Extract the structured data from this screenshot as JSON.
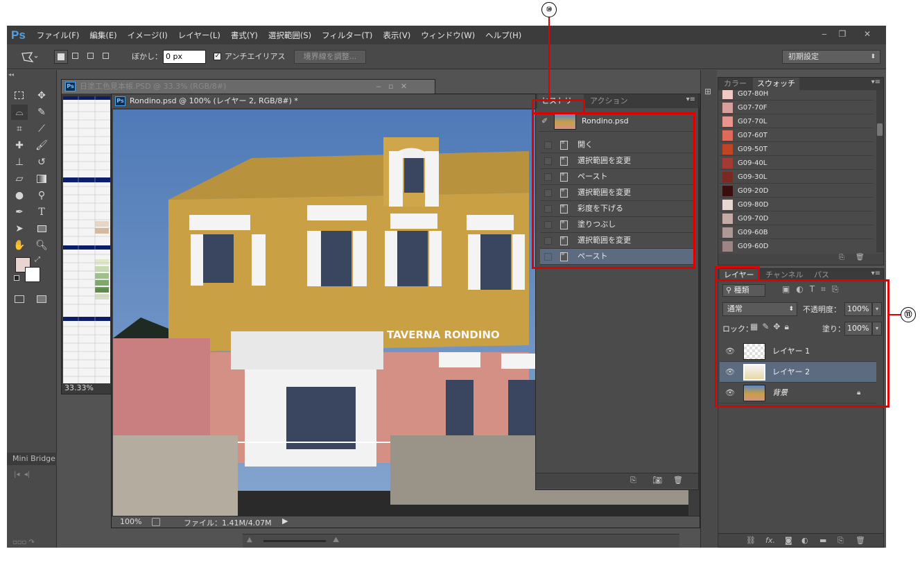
{
  "callouts": {
    "history": "⑩",
    "layers": "⑪"
  },
  "menubar": {
    "logo": "Ps",
    "items": [
      "ファイル(F)",
      "編集(E)",
      "イメージ(I)",
      "レイヤー(L)",
      "書式(Y)",
      "選択範囲(S)",
      "フィルター(T)",
      "表示(V)",
      "ウィンドウ(W)",
      "ヘルプ(H)"
    ],
    "minimize": "‒",
    "restore": "❐",
    "close": "✕"
  },
  "options": {
    "feather_label": "ぼかし：",
    "feather_value": "0 px",
    "antialias_label": "アンチエイリアス",
    "antialias_checked": true,
    "refine_edge": "境界線を調整...",
    "workspace": "初期設定"
  },
  "doc1": {
    "title": "日塗工色見本帳.PSD @ 33.3% (RGB/8#)",
    "zoom": "33.33%"
  },
  "doc2": {
    "title": "Rondino.psd @ 100% (レイヤー 2, RGB/8#) *",
    "zoom": "100%",
    "file_info": "ファイル：1.41M/4.07M",
    "sign_text": "TAVERNA RONDINO"
  },
  "mini_bridge": {
    "title": "Mini Bridge"
  },
  "history": {
    "tabs": [
      "ヒストリー",
      "アクション"
    ],
    "snapshot": "Rondino.psd",
    "states": [
      "開く",
      "選択範囲を変更",
      "ペースト",
      "選択範囲を変更",
      "彩度を下げる",
      "塗りつぶし",
      "選択範囲を変更",
      "ペースト"
    ],
    "selected_index": 7
  },
  "color_panel": {
    "tabs": [
      "カラー",
      "スウォッチ"
    ],
    "swatches": [
      {
        "name": "G07-80H",
        "color": "#f1c8c2"
      },
      {
        "name": "G07-70F",
        "color": "#d9a09b"
      },
      {
        "name": "G07-70L",
        "color": "#e8958d"
      },
      {
        "name": "G07-60T",
        "color": "#de6a5a"
      },
      {
        "name": "G09-50T",
        "color": "#c24426"
      },
      {
        "name": "G09-40L",
        "color": "#a33b32"
      },
      {
        "name": "G09-30L",
        "color": "#7a2a22"
      },
      {
        "name": "G09-20D",
        "color": "#3a0e0c"
      },
      {
        "name": "G09-80D",
        "color": "#e8d6d2"
      },
      {
        "name": "G09-70D",
        "color": "#c6aaa6"
      },
      {
        "name": "G09-60B",
        "color": "#ad9896"
      },
      {
        "name": "G09-60D",
        "color": "#9c8582"
      }
    ]
  },
  "layers_panel": {
    "tabs": [
      "レイヤー",
      "チャンネル",
      "パス"
    ],
    "filter": "種類",
    "blend_mode": "通常",
    "opacity_label": "不透明度：",
    "opacity": "100%",
    "lock_label": "ロック：",
    "fill_label": "塗り：",
    "fill": "100%",
    "layers": [
      {
        "name": "レイヤー 1",
        "selected": false,
        "locked": false
      },
      {
        "name": "レイヤー 2",
        "selected": true,
        "locked": false
      },
      {
        "name": "背景",
        "selected": false,
        "locked": true
      }
    ]
  }
}
